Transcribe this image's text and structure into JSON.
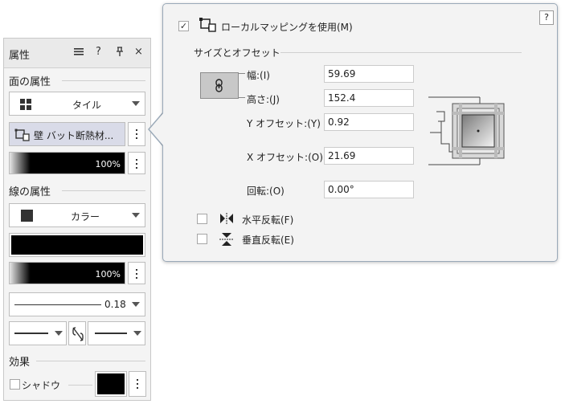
{
  "attributes_panel": {
    "title": "属性",
    "header_icons": {
      "menu": "menu-icon",
      "help": "?",
      "pin": "pin-icon",
      "close": "×"
    },
    "face_section": {
      "label": "面の属性",
      "fill_type": "タイル",
      "fill_type_icon": "tile-icon",
      "tile_name": "壁 バット断熱材...",
      "opacity": "100%"
    },
    "line_section": {
      "label": "線の属性",
      "line_type": "カラー",
      "line_color": "#000000",
      "opacity": "100%",
      "thickness": "0.18"
    },
    "effect_section": {
      "label": "効果",
      "shadow_label": "シャドウ",
      "shadow_checked": false,
      "shadow_color": "#000000"
    }
  },
  "mapping_popup": {
    "help": "?",
    "use_local_mapping_label": "ローカルマッピングを使用(M)",
    "use_local_mapping_checked": true,
    "size_offset_heading": "サイズとオフセット",
    "fields": [
      {
        "label": "幅:(I)",
        "value": "59.69"
      },
      {
        "label": "高さ:(J)",
        "value": "152.4"
      },
      {
        "label": "Y オフセット:(Y)",
        "value": "0.92"
      },
      {
        "label": "X オフセット:(O)",
        "value": "21.69"
      },
      {
        "label": "回転:(O)",
        "value": "0.00°"
      }
    ],
    "flip_horizontal_label": "水平反転(F)",
    "flip_horizontal_checked": false,
    "flip_vertical_label": "垂直反転(E)",
    "flip_vertical_checked": false
  },
  "colors": {
    "accent_gray": "#9aa9b8",
    "panel_bg": "#f4f4f4",
    "popup_bg": "#f3f3f3"
  }
}
